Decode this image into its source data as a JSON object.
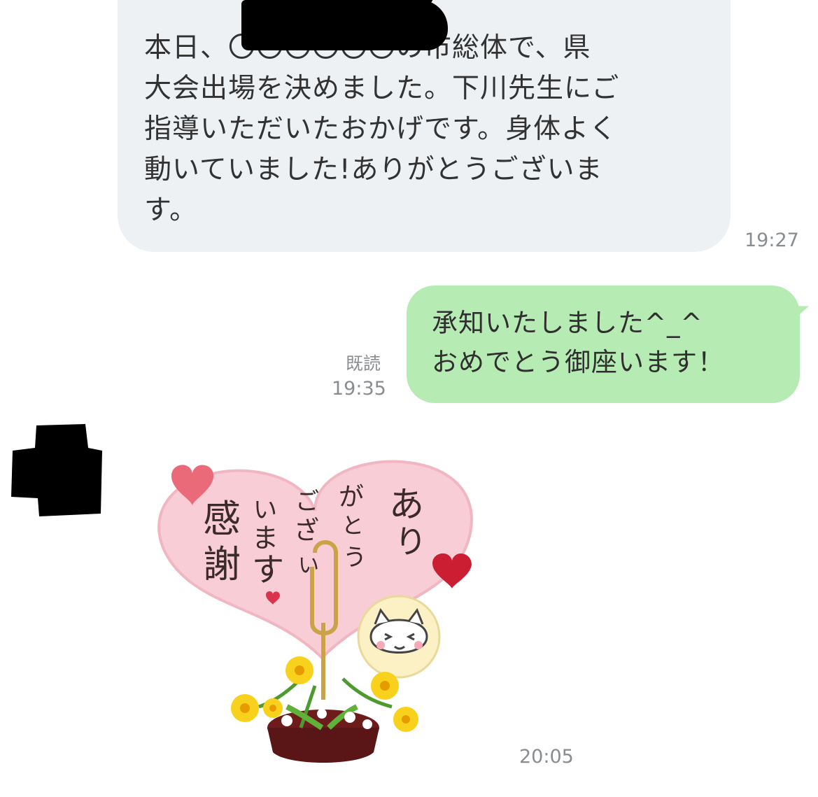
{
  "messages": [
    {
      "direction": "incoming",
      "text": "本日、〇〇〇〇〇〇の市総体で、県\n大会出場を決めました。下川先生にご\n指導いただいたおかげです。身体よく\n動いていました!ありがとうございま\nす。",
      "time": "19:27"
    },
    {
      "direction": "outgoing",
      "text": "承知いたしました^_^\nおめでとう御座います！",
      "read_label": "既読",
      "time": "19:35"
    },
    {
      "direction": "incoming",
      "type": "sticker",
      "sticker_text": [
        "感謝",
        "います",
        "ございます",
        "ありがとう"
      ],
      "time": "20:05"
    }
  ],
  "colors": {
    "incoming_bubble": "#eef1f4",
    "outgoing_bubble": "#b7ebb4",
    "timestamp": "#888d92"
  }
}
